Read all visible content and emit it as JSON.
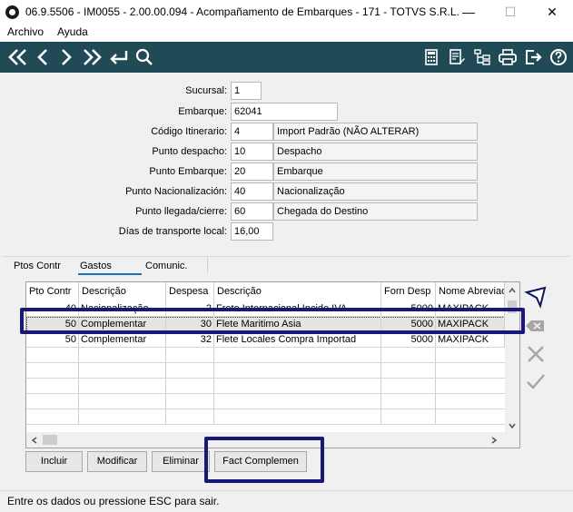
{
  "window": {
    "title": "06.9.5506 - IM0055 - 2.00.00.094 - Acompanamento de Embarques - 171 - TOTVS S.R.L.",
    "title_display": "06.9.5506 - IM0055 - 2.00.00.094 - Acompañamento de Embarques - 171 - TOTVS S.R.L.",
    "min_glyph": "—",
    "max_glyph": "☐",
    "close_glyph": "✕"
  },
  "menu": {
    "archivo": "Archivo",
    "ayuda": "Ayuda"
  },
  "toolbar": {
    "icons": [
      "first-icon",
      "previous-icon",
      "next-icon",
      "last-icon",
      "return-icon",
      "search-icon",
      "calculator-icon",
      "edit-document-icon",
      "tree-icon",
      "print-icon",
      "exit-icon",
      "help-icon"
    ],
    "color": "#1f4a56"
  },
  "form": {
    "sucursal": {
      "label": "Sucursal:",
      "value": "1"
    },
    "embarque": {
      "label": "Embarque:",
      "value": "62041"
    },
    "itinerario": {
      "label": "Código Itinerario:",
      "value": "4",
      "desc": "Import Padrão (NÃO ALTERAR)"
    },
    "despacho": {
      "label": "Punto despacho:",
      "value": "10",
      "desc": "Despacho"
    },
    "pto_embarque": {
      "label": "Punto Embarque:",
      "value": "20",
      "desc": "Embarque"
    },
    "nacionalizacion": {
      "label": "Punto Nacionalización:",
      "value": "40",
      "desc": "Nacionalização"
    },
    "llegada": {
      "label": "Punto llegada/cierre:",
      "value": "60",
      "desc": "Chegada do Destino"
    },
    "dias": {
      "label": "Días de transporte local:",
      "value": "16,00"
    }
  },
  "tabs": {
    "ptos": "Ptos Contr",
    "gastos": "Gastos",
    "comunic": "Comunic.",
    "active_color": "#1e73b8"
  },
  "grid": {
    "headers": [
      "Pto Contr",
      "Descrição",
      "Despesa",
      "Descrição",
      "Forn Desp",
      "Nome Abreviado"
    ],
    "rows": [
      [
        "40",
        "Nacionalização",
        "2",
        "Frete Internacional Incide IVA",
        "5000",
        "MAXIPACK"
      ],
      [
        "50",
        "Complementar",
        "30",
        "Flete Maritimo Asia",
        "5000",
        "MAXIPACK"
      ],
      [
        "50",
        "Complementar",
        "32",
        "Flete Locales Compra Importad",
        "5000",
        "MAXIPACK"
      ]
    ],
    "selected_row": 1
  },
  "side_buttons": [
    "pointer-icon",
    "erase-icon",
    "cancel-icon",
    "confirm-icon"
  ],
  "buttons": {
    "incluir": "Incluir",
    "modificar": "Modificar",
    "eliminar": "Eliminar",
    "fact": "Fact Complemen"
  },
  "highlight_color": "#17187a",
  "status": "Entre os dados ou pressione ESC para sair."
}
